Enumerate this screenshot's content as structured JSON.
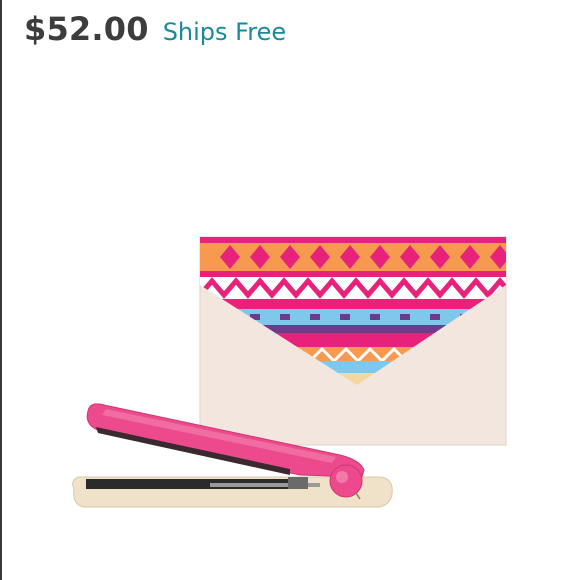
{
  "listing": {
    "price": "$52.00",
    "shipping": "Ships Free"
  },
  "product_image": {
    "items": [
      "pink-flat-iron",
      "aztec-print-clutch-envelope"
    ],
    "colors": {
      "background": "#ffffff",
      "envelope": "#f3e6de",
      "flat_iron": "#ec4a8c",
      "iron_base": "#f0e2c8",
      "pattern_pink": "#e8217a",
      "pattern_orange": "#f79a4f",
      "pattern_blue": "#7fc8ec",
      "pattern_purple": "#6f3a8c"
    }
  }
}
